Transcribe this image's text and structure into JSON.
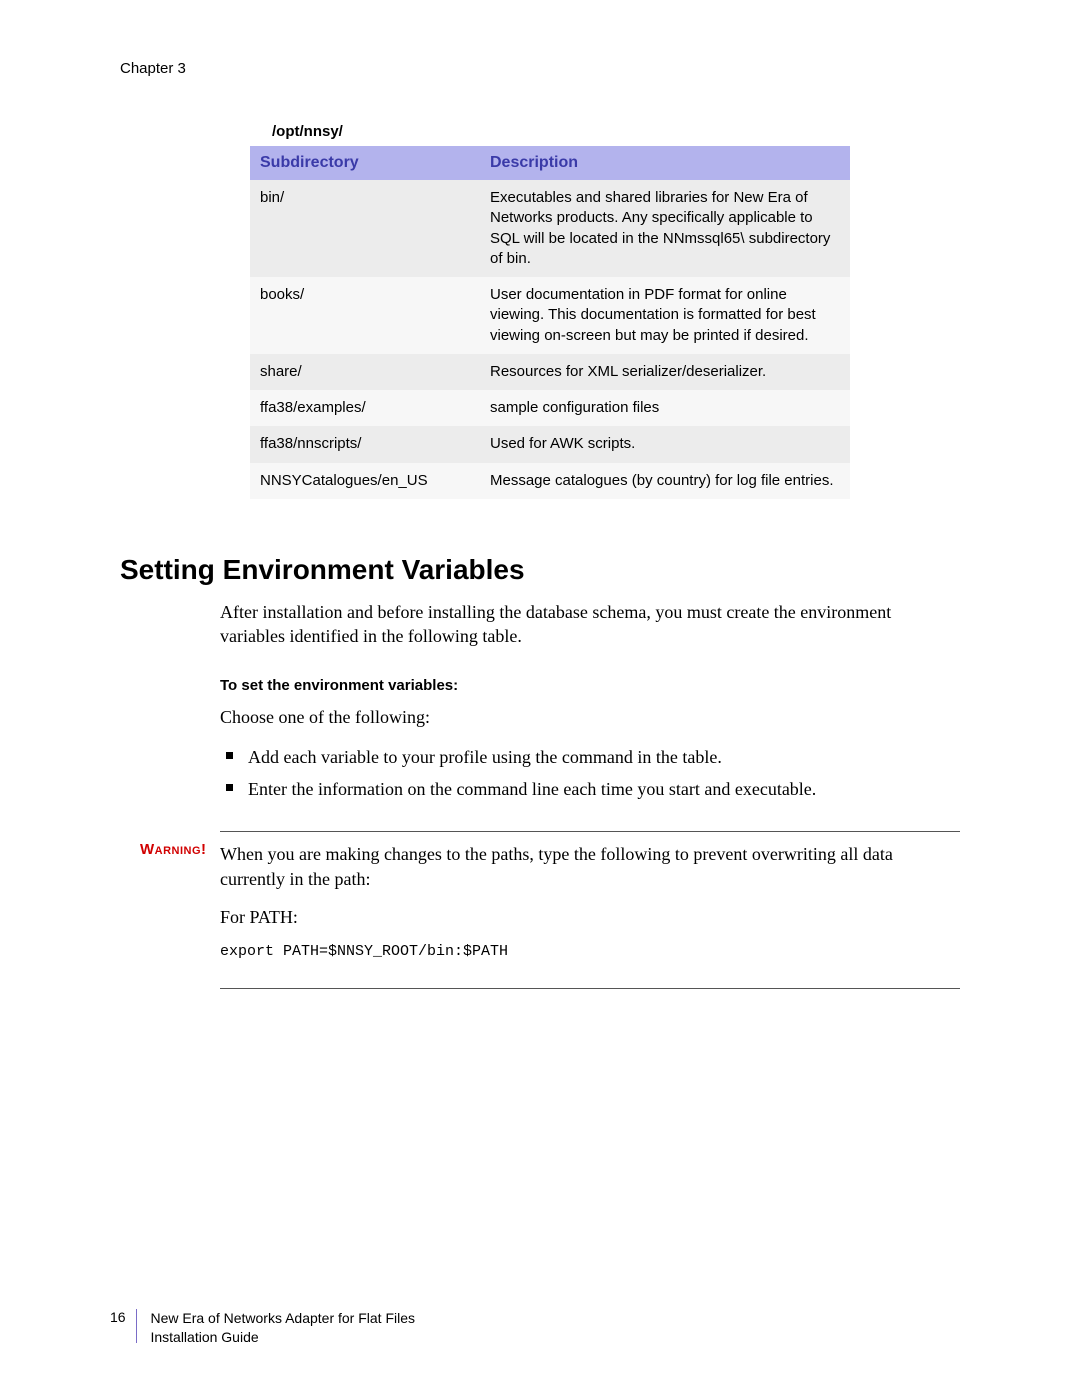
{
  "header": {
    "chapter": "Chapter 3"
  },
  "table": {
    "caption": "/opt/nnsy/",
    "columns": [
      "Subdirectory",
      "Description"
    ],
    "rows": [
      {
        "subdir": "bin/",
        "desc": "Executables and shared libraries for New Era of Networks products. Any specifically applicable to SQL will be located in the NNmssql65\\ subdirectory of bin."
      },
      {
        "subdir": "books/",
        "desc": "User documentation in PDF format for online viewing. This documentation is formatted for best viewing on-screen but may be printed if desired."
      },
      {
        "subdir": "share/",
        "desc": "Resources for XML serializer/deserializer."
      },
      {
        "subdir": "ffa38/examples/",
        "desc": "sample configuration files"
      },
      {
        "subdir": "ffa38/nnscripts/",
        "desc": "Used for AWK scripts."
      },
      {
        "subdir": "NNSYCatalogues/en_US",
        "desc": "Message catalogues (by country) for log file entries."
      }
    ]
  },
  "section": {
    "heading": "Setting Environment Variables",
    "intro": "After installation and before installing the database schema, you must create the environment variables identified in the following table.",
    "subheading": "To set the environment variables:",
    "choose": "Choose one of the following:",
    "bullets": [
      "Add each variable to your profile using the command in the table.",
      "Enter the information on the command line each time you start and executable."
    ]
  },
  "warning": {
    "label": "Warning!",
    "p1": "When you are making changes to the paths, type the following to prevent overwriting all data currently in the path:",
    "p2": "For PATH:",
    "code": "export PATH=$NNSY_ROOT/bin:$PATH"
  },
  "footer": {
    "page": "16",
    "line1": "New Era of Networks Adapter for Flat Files",
    "line2": "Installation Guide"
  }
}
